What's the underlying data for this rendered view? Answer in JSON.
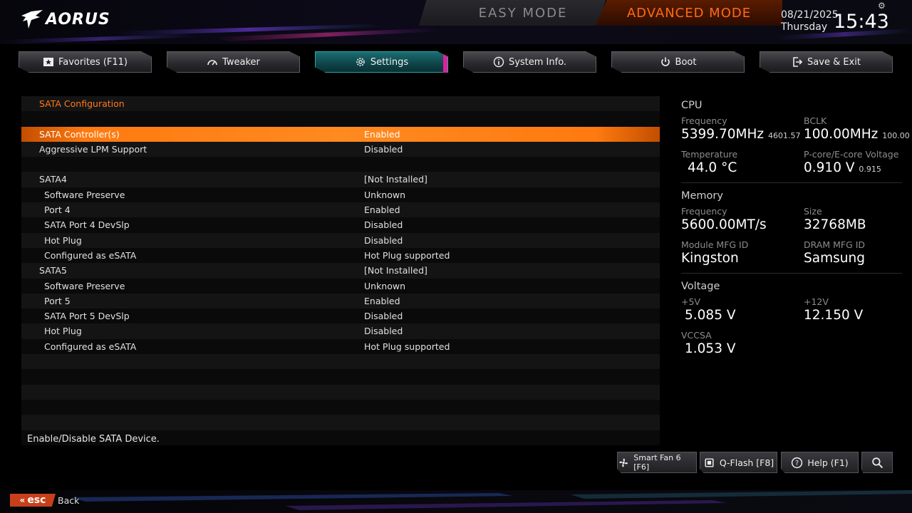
{
  "header": {
    "brand": "AORUS",
    "easy_mode": "EASY MODE",
    "advanced_mode": "ADVANCED MODE",
    "date": "08/21/2025",
    "day": "Thursday",
    "time": "15:43"
  },
  "nav": [
    {
      "label": "Favorites (F11)",
      "icon": "star-icon"
    },
    {
      "label": "Tweaker",
      "icon": "gauge-icon"
    },
    {
      "label": "Settings",
      "icon": "gear-icon",
      "active": true
    },
    {
      "label": "System Info.",
      "icon": "info-icon"
    },
    {
      "label": "Boot",
      "icon": "power-icon"
    },
    {
      "label": "Save & Exit",
      "icon": "exit-icon"
    }
  ],
  "list": {
    "section_title": "SATA Configuration",
    "rows": [
      {
        "label": "SATA Controller(s)",
        "value": "Enabled",
        "selected": true
      },
      {
        "label": "Aggressive LPM Support",
        "value": "Disabled"
      },
      {
        "label": "SATA4",
        "value": "[Not Installed]"
      },
      {
        "label": "Software Preserve",
        "value": "Unknown",
        "sub": true
      },
      {
        "label": "Port 4",
        "value": "Enabled",
        "sub": true
      },
      {
        "label": "SATA Port 4 DevSlp",
        "value": "Disabled",
        "sub": true
      },
      {
        "label": "Hot Plug",
        "value": "Disabled",
        "sub": true
      },
      {
        "label": "Configured as eSATA",
        "value": "Hot Plug supported",
        "sub": true
      },
      {
        "label": "SATA5",
        "value": "[Not Installed]"
      },
      {
        "label": "Software Preserve",
        "value": "Unknown",
        "sub": true
      },
      {
        "label": "Port 5",
        "value": "Enabled",
        "sub": true
      },
      {
        "label": "SATA Port 5 DevSlp",
        "value": "Disabled",
        "sub": true
      },
      {
        "label": "Hot Plug",
        "value": "Disabled",
        "sub": true
      },
      {
        "label": "Configured as eSATA",
        "value": "Hot Plug supported",
        "sub": true
      }
    ]
  },
  "help": "Enable/Disable SATA Device.",
  "panel": {
    "cpu": {
      "title": "CPU",
      "frequency_label": "Frequency",
      "frequency": "5399.70MHz",
      "frequency_sub": "4601.57",
      "bclk_label": "BCLK",
      "bclk": "100.00MHz",
      "bclk_sub": "100.00",
      "temp_label": "Temperature",
      "temp": "44.0 °C",
      "volt_label": "P-core/E-core Voltage",
      "volt": "0.910 V",
      "volt_sub": "0.915"
    },
    "memory": {
      "title": "Memory",
      "frequency_label": "Frequency",
      "frequency": "5600.00MT/s",
      "size_label": "Size",
      "size": "32768MB",
      "module_label": "Module MFG ID",
      "module": "Kingston",
      "dram_label": "DRAM MFG ID",
      "dram": "Samsung"
    },
    "voltage": {
      "title": "Voltage",
      "v5_label": "+5V",
      "v5": "5.085 V",
      "v12_label": "+12V",
      "v12": "12.150 V",
      "vccsa_label": "VCCSA",
      "vccsa": "1.053 V"
    }
  },
  "tools": {
    "smartfan": "Smart Fan 6 [F6]",
    "qflash": "Q-Flash [F8]",
    "help": "Help (F1)"
  },
  "footer": {
    "esc": "esc",
    "back": "Back"
  },
  "colors": {
    "accent_orange": "#ff7a10",
    "accent_teal": "#1c6d72",
    "accent_pink": "#e0209a"
  }
}
